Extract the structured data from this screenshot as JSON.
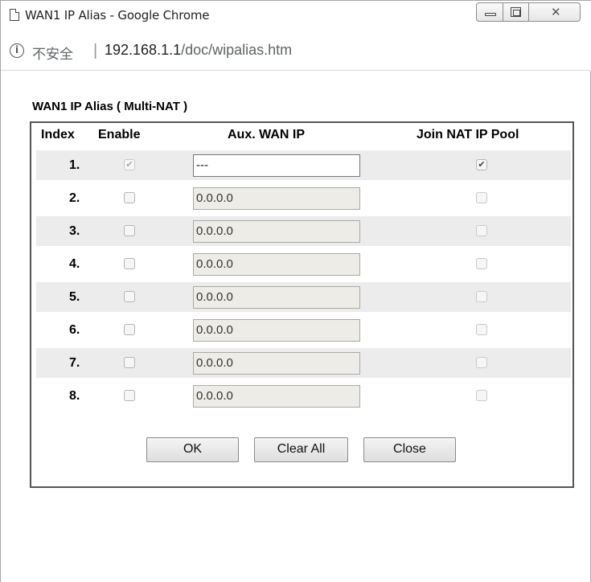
{
  "window": {
    "title": "WAN1 IP Alias - Google Chrome"
  },
  "address": {
    "security": "不安全",
    "separator": "|",
    "host": "192.168.1.1",
    "path": "/doc/wipalias.htm"
  },
  "page": {
    "section_title": "WAN1 IP Alias ( Multi-NAT )",
    "columns": {
      "index": "Index",
      "enable": "Enable",
      "aux_ip": "Aux. WAN IP",
      "join_pool": "Join NAT IP Pool"
    },
    "rows": [
      {
        "index": "1.",
        "enabled": true,
        "enable_disabled": true,
        "ip": "---",
        "ip_editable": true,
        "join": true,
        "join_disabled": false
      },
      {
        "index": "2.",
        "enabled": false,
        "enable_disabled": false,
        "ip": "0.0.0.0",
        "ip_editable": false,
        "join": false,
        "join_disabled": true
      },
      {
        "index": "3.",
        "enabled": false,
        "enable_disabled": false,
        "ip": "0.0.0.0",
        "ip_editable": false,
        "join": false,
        "join_disabled": true
      },
      {
        "index": "4.",
        "enabled": false,
        "enable_disabled": false,
        "ip": "0.0.0.0",
        "ip_editable": false,
        "join": false,
        "join_disabled": true
      },
      {
        "index": "5.",
        "enabled": false,
        "enable_disabled": false,
        "ip": "0.0.0.0",
        "ip_editable": false,
        "join": false,
        "join_disabled": true
      },
      {
        "index": "6.",
        "enabled": false,
        "enable_disabled": false,
        "ip": "0.0.0.0",
        "ip_editable": false,
        "join": false,
        "join_disabled": true
      },
      {
        "index": "7.",
        "enabled": false,
        "enable_disabled": false,
        "ip": "0.0.0.0",
        "ip_editable": false,
        "join": false,
        "join_disabled": true
      },
      {
        "index": "8.",
        "enabled": false,
        "enable_disabled": false,
        "ip": "0.0.0.0",
        "ip_editable": false,
        "join": false,
        "join_disabled": true
      }
    ],
    "buttons": {
      "ok": "OK",
      "clear_all": "Clear All",
      "close": "Close"
    }
  },
  "colors": {
    "row_shade": "#ececec",
    "readonly_field": "#eeece6",
    "table_border": "#555555"
  }
}
